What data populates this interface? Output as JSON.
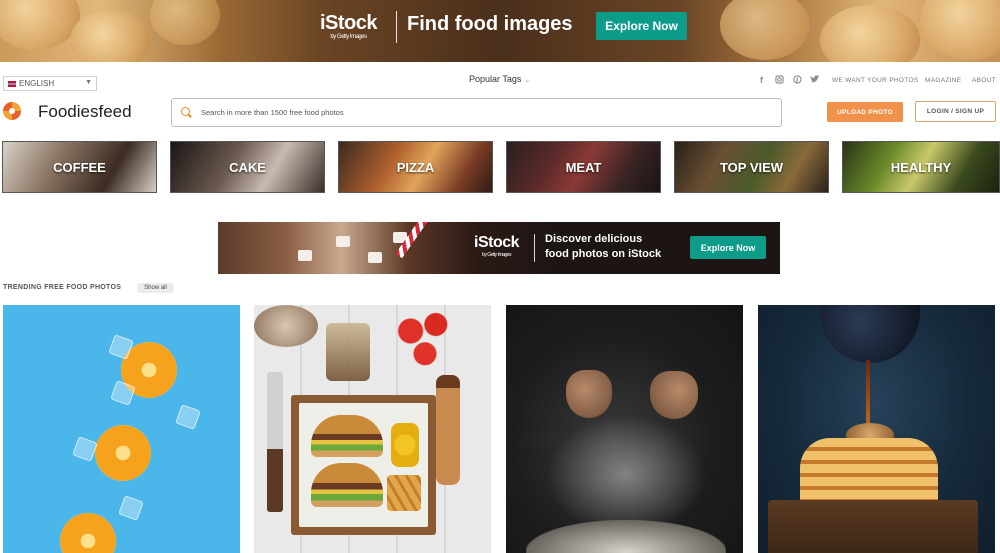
{
  "top_ad": {
    "logo": "iStock",
    "logo_sub": "by Getty Images",
    "headline": "Find food images",
    "cta": "Explore Now"
  },
  "header": {
    "language": "ENGLISH",
    "popular_tags": "Popular Tags",
    "social_icons": [
      "facebook-icon",
      "instagram-icon",
      "pinterest-icon",
      "twitter-icon"
    ],
    "links": [
      "WE WANT YOUR PHOTOS",
      "MAGAZINE",
      "ABOUT"
    ],
    "logo_text": "Foodiesfeed",
    "search_placeholder": "Search in more than 1500 free food photos",
    "upload": "UPLOAD PHOTO",
    "login": "LOGIN / SIGN UP"
  },
  "categories": [
    {
      "label": "COFFEE",
      "color": "#6e5a4a"
    },
    {
      "label": "CAKE",
      "color": "#5e4c46"
    },
    {
      "label": "PIZZA",
      "color": "#7a4a33"
    },
    {
      "label": "MEAT",
      "color": "#3e2a27"
    },
    {
      "label": "TOP VIEW",
      "color": "#4a3b2b"
    },
    {
      "label": "HEALTHY",
      "color": "#3c4a25"
    }
  ],
  "mid_ad": {
    "logo": "iStock",
    "logo_sub": "by Getty Images",
    "line1": "Discover delicious",
    "line2": "food photos on iStock",
    "cta": "Explore Now"
  },
  "trending": {
    "title": "TRENDING FREE FOOD PHOTOS",
    "show_all": "Show all"
  },
  "colors": {
    "accent_teal": "#0d9b8a",
    "upload_orange": "#f0924a"
  }
}
